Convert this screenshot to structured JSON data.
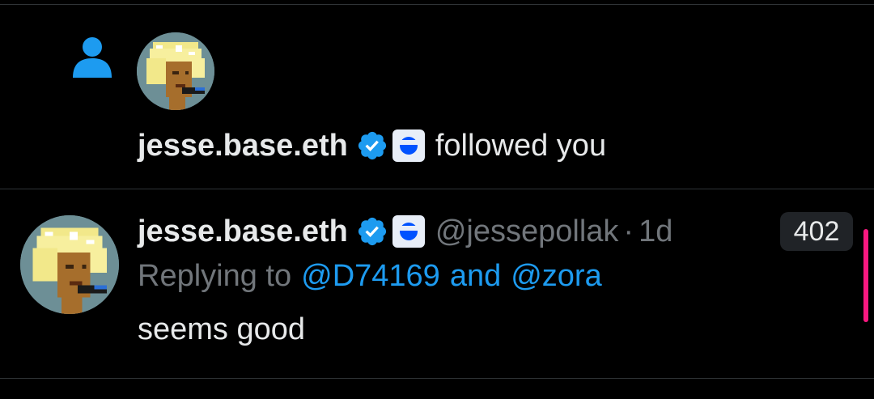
{
  "notification": {
    "username": "jesse.base.eth",
    "action_text": "followed you",
    "icons": [
      "person-icon",
      "verified-badge-icon",
      "base-logo-icon"
    ]
  },
  "tweet": {
    "display_name": "jesse.base.eth",
    "handle": "@jessepollak",
    "separator": "·",
    "time": "1d",
    "reply_prefix": "Replying to",
    "reply_mention_1": "@D74169",
    "reply_and": "and",
    "reply_mention_2": "@zora",
    "body": "seems good",
    "count_badge": "402"
  },
  "colors": {
    "background": "#000000",
    "text_primary": "#e7e9ea",
    "text_secondary": "#71767b",
    "accent_blue": "#1d9bf0",
    "divider": "#2f3336",
    "scroll_indicator": "#f91880",
    "badge_bg": "#202327"
  }
}
